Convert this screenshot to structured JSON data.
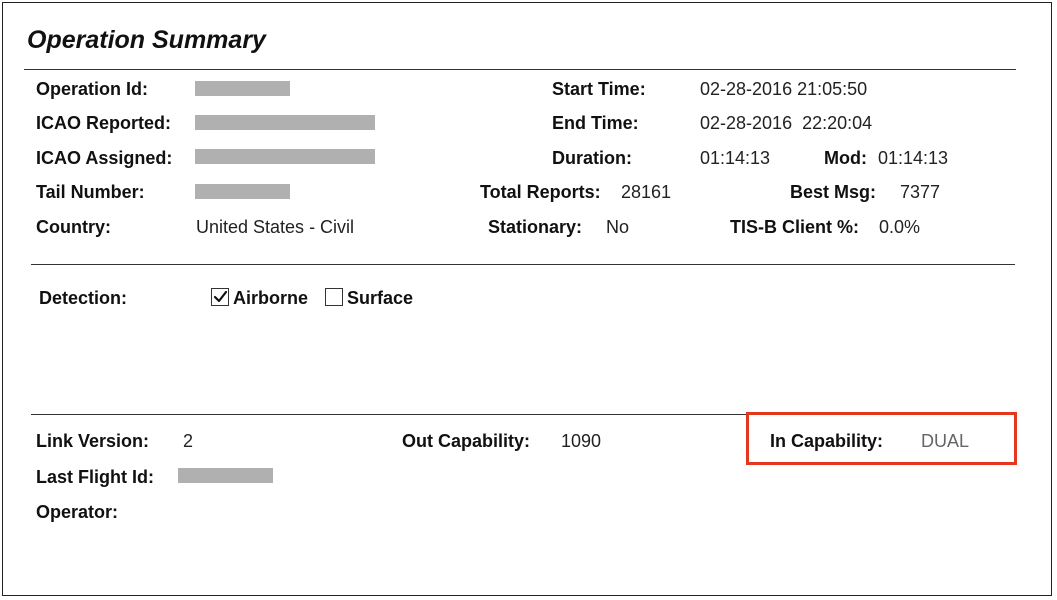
{
  "title": "Operation Summary",
  "fields": {
    "operation_id": {
      "label": "Operation Id:"
    },
    "icao_reported": {
      "label": "ICAO Reported:"
    },
    "icao_assigned": {
      "label": "ICAO Assigned:"
    },
    "tail_number": {
      "label": "Tail Number:"
    },
    "country": {
      "label": "Country:",
      "value": "United States - Civil"
    },
    "start_time": {
      "label": "Start Time:",
      "value": "02-28-2016 21:05:50"
    },
    "end_time": {
      "label": "End Time:",
      "value": "02-28-2016  22:20:04"
    },
    "duration": {
      "label": "Duration:",
      "value": "01:14:13"
    },
    "mod": {
      "label": "Mod:",
      "value": "01:14:13"
    },
    "total_reports": {
      "label": "Total Reports:",
      "value": "28161"
    },
    "best_msg": {
      "label": "Best Msg:",
      "value": "7377"
    },
    "stationary": {
      "label": "Stationary:",
      "value": "No"
    },
    "tisb_client": {
      "label": "TIS-B Client %:",
      "value": "0.0%"
    }
  },
  "detection": {
    "label": "Detection:",
    "airborne": {
      "label": "Airborne",
      "checked": true
    },
    "surface": {
      "label": "Surface",
      "checked": false
    }
  },
  "capability": {
    "link_version": {
      "label": "Link Version:",
      "value": "2"
    },
    "out_capability": {
      "label": "Out Capability:",
      "value": "1090"
    },
    "in_capability": {
      "label": "In Capability:",
      "value": "DUAL"
    },
    "last_flight_id": {
      "label": "Last Flight Id:"
    },
    "operator": {
      "label": "Operator:"
    }
  },
  "colors": {
    "highlight_border": "#e3371e",
    "redaction": "#b0b0b0"
  },
  "icons": {
    "checked": "check-mark-icon"
  }
}
